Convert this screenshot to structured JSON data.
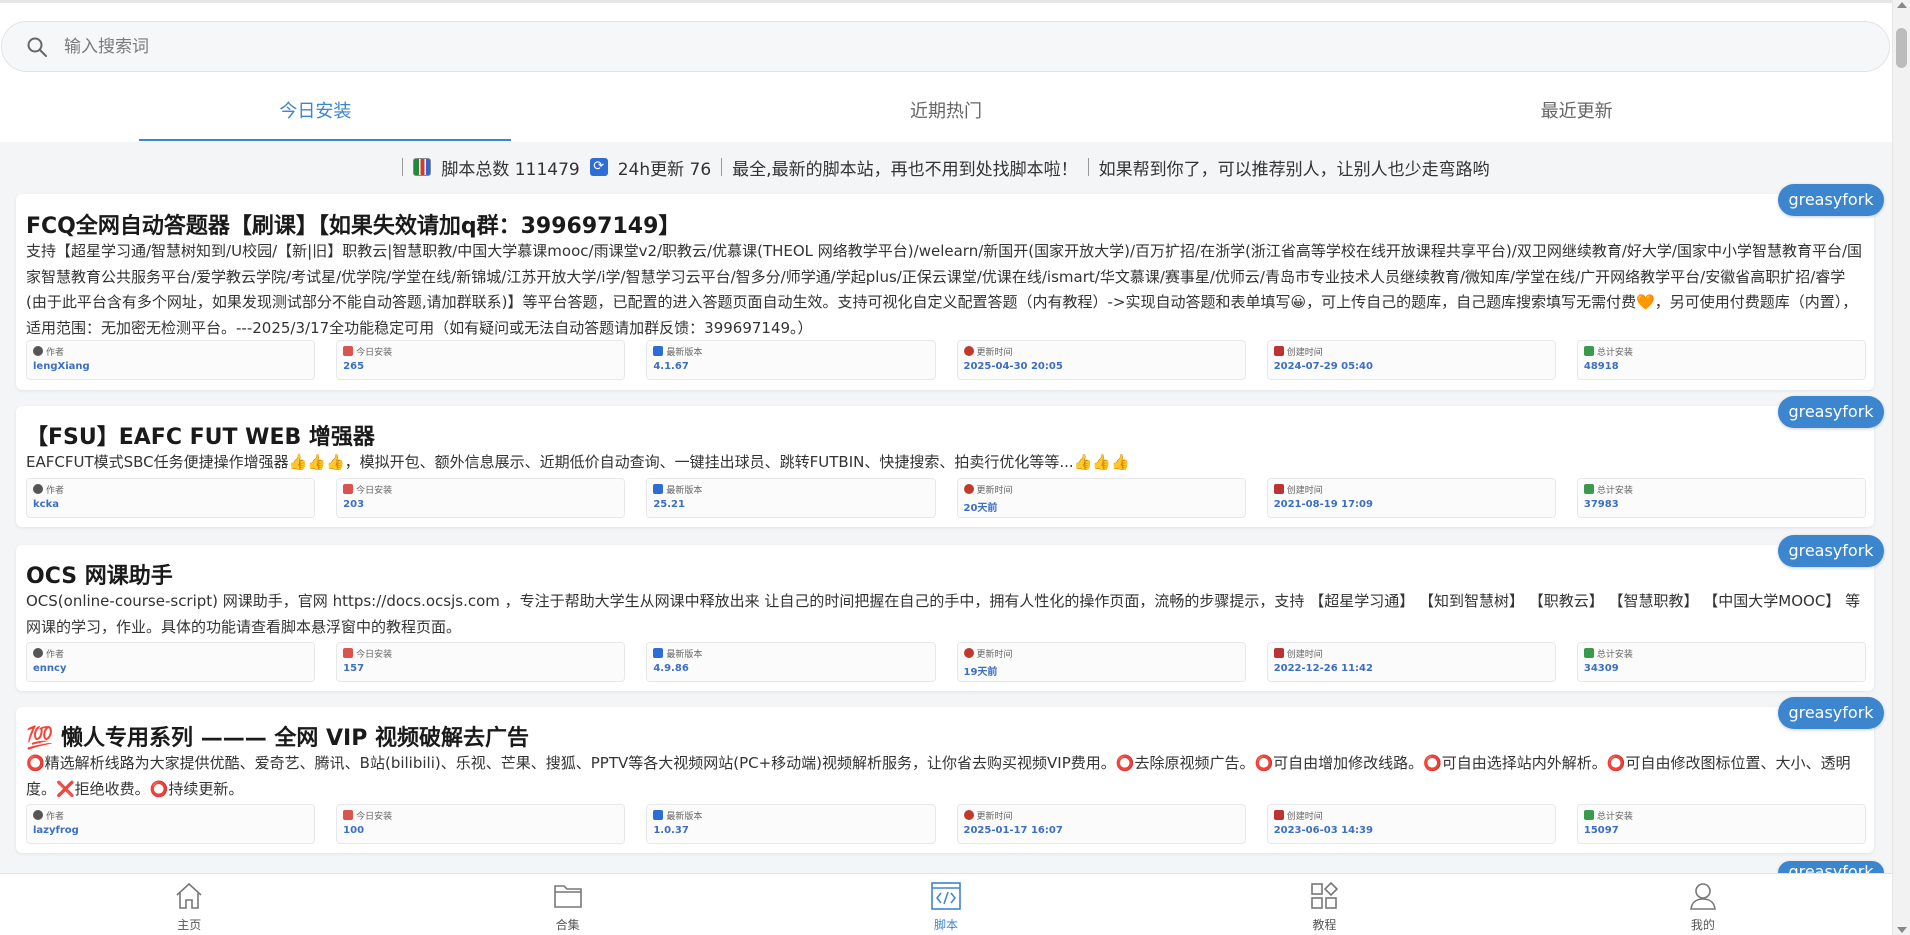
{
  "search": {
    "placeholder": "输入搜索词"
  },
  "tabs": [
    {
      "label": "今日安装",
      "active": true
    },
    {
      "label": "近期热门",
      "active": false
    },
    {
      "label": "最近更新",
      "active": false
    }
  ],
  "stats": {
    "total_label": "脚本总数 111479",
    "updated_label": "24h更新 76",
    "slogan": "最全,最新的脚本站，再也不用到处找脚本啦！",
    "share": "如果帮到你了，可以推荐别人，让别人也少走弯路哟"
  },
  "meta_labels": {
    "author": "作者",
    "today": "今日安装",
    "version": "最新版本",
    "updated": "更新时间",
    "created": "创建时间",
    "total": "总计安装"
  },
  "cards": [
    {
      "badge": "greasyfork",
      "title": "FCQ全网自动答题器【刷课】【如果失效请加q群：399697149】",
      "desc": "支持【超星学习通/智慧树知到/U校园/【新|旧】职教云|智慧职教/中国大学慕课mooc/雨课堂v2/职教云/优慕课(THEOL 网络教学平台)/welearn/新国开(国家开放大学)/百万扩招/在浙学(浙江省高等学校在线开放课程共享平台)/双卫网继续教育/好大学/国家中小学智慧教育平台/国家智慧教育公共服务平台/爱学教云学院/考试星/优学院/学堂在线/新锦城/江苏开放大学/i学/智慧学习云平台/智多分/师学通/学起plus/正保云课堂/优课在线/ismart/华文慕课/赛事星/优师云/青岛市专业技术人员继续教育/微知库/学堂在线/广开网络教学平台/安徽省高职扩招/睿学(由于此平台含有多个网址，如果发现测试部分不能自动答题,请加群联系)】等平台答题，已配置的进入答题页面自动生效。支持可视化自定义配置答题（内有教程）->实现自动答题和表单填写😀，可上传自己的题库，自己题库搜索填写无需付费🧡，另可使用付费题库（内置），适用范围：无加密无检测平台。---2025/3/17全功能稳定可用（如有疑问或无法自动答题请加群反馈：399697149。）",
      "author": "lengXiang",
      "today": "265",
      "version": "4.1.67",
      "updated": "2025-04-30 20:05",
      "created": "2024-07-29 05:40",
      "total": "48918"
    },
    {
      "badge": "greasyfork",
      "title": "【FSU】EAFC FUT WEB 增强器",
      "desc": "EAFCFUT模式SBC任务便捷操作增强器👍👍👍，模拟开包、额外信息展示、近期低价自动查询、一键挂出球员、跳转FUTBIN、快捷搜索、拍卖行优化等等...👍👍👍",
      "author": "kcka",
      "today": "203",
      "version": "25.21",
      "updated": "20天前",
      "created": "2021-08-19 17:09",
      "total": "37983"
    },
    {
      "badge": "greasyfork",
      "title": "OCS 网课助手",
      "desc": "OCS(online-course-script) 网课助手，官网 https://docs.ocsjs.com ，专注于帮助大学生从网课中释放出来 让自己的时间把握在自己的手中，拥有人性化的操作页面，流畅的步骤提示，支持 【超星学习通】 【知到智慧树】 【职教云】 【智慧职教】 【中国大学MOOC】 等网课的学习，作业。具体的功能请查看脚本悬浮窗中的教程页面。",
      "author": "enncy",
      "today": "157",
      "version": "4.9.86",
      "updated": "19天前",
      "created": "2022-12-26 11:42",
      "total": "34309"
    },
    {
      "badge": "greasyfork",
      "title": "💯 懒人专用系列 ——— 全网 VIP 视频破解去广告",
      "desc": "⭕精选解析线路为大家提供优酷、爱奇艺、腾讯、B站(bilibili)、乐视、芒果、搜狐、PPTV等各大视频网站(PC+移动端)视频解析服务，让你省去购买视频VIP费用。⭕去除原视频广告。⭕可自由增加修改线路。⭕可自由选择站内外解析。⭕可自由修改图标位置、大小、透明度。❌拒绝收费。⭕持续更新。",
      "author": "lazyfrog",
      "today": "100",
      "version": "1.0.37",
      "updated": "2025-01-17 16:07",
      "created": "2023-06-03 14:39",
      "total": "15097"
    }
  ],
  "partial_badge": "greasyfork",
  "bottom_nav": [
    {
      "label": "主页",
      "icon": "home-icon",
      "active": false
    },
    {
      "label": "合集",
      "icon": "folder-icon",
      "active": false
    },
    {
      "label": "脚本",
      "icon": "code-icon",
      "active": true
    },
    {
      "label": "教程",
      "icon": "apps-icon",
      "active": false
    },
    {
      "label": "我的",
      "icon": "user-icon",
      "active": false
    }
  ],
  "colors": {
    "accent": "#3b86cf",
    "meta_value": "#3b6fc4"
  }
}
